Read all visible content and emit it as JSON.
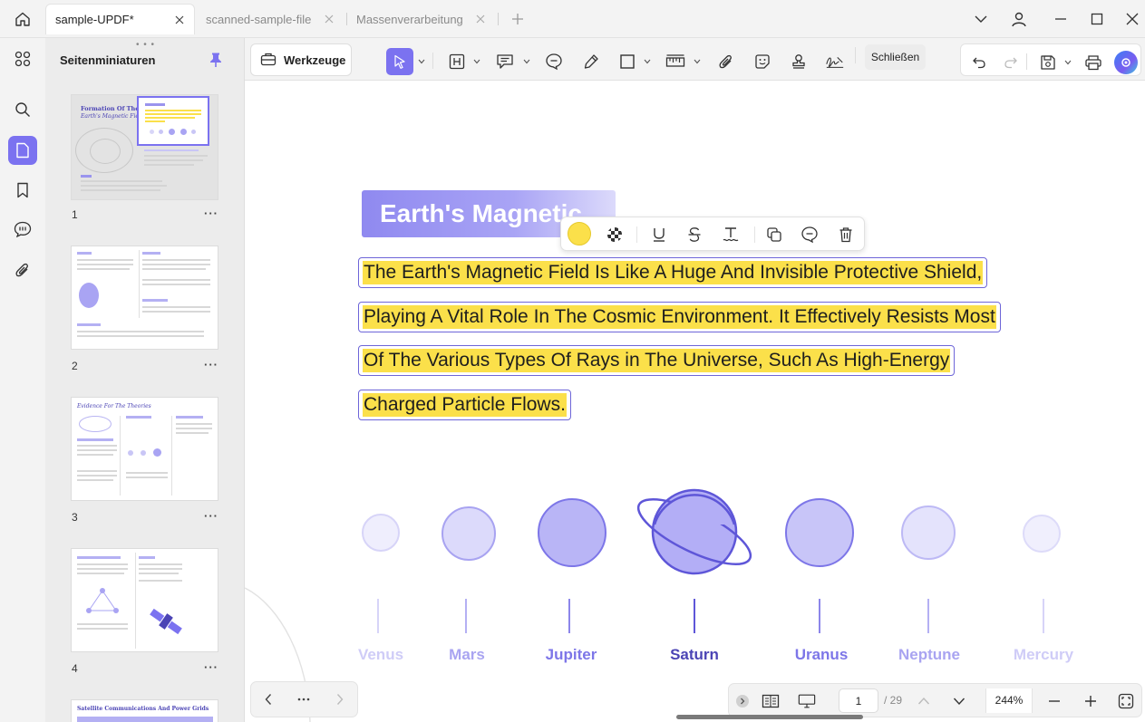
{
  "tabs": [
    {
      "label": "sample-UPDF*",
      "active": true
    },
    {
      "label": "scanned-sample-file",
      "active": false
    },
    {
      "label": "Massenverarbeitung",
      "active": false
    }
  ],
  "sidebar": {
    "title": "Seitenminiaturen",
    "pages": [
      {
        "num": "1",
        "more": "···",
        "title": "Formation Of The",
        "subtitle": "Earth's Magnetic Field"
      },
      {
        "num": "2",
        "more": "···"
      },
      {
        "num": "3",
        "more": "···",
        "title": "Evidence For The Theories"
      },
      {
        "num": "4",
        "more": "···"
      },
      {
        "title": "Satellite Communications And Power Grids"
      }
    ]
  },
  "toolbar": {
    "tools_label": "Werkzeuge",
    "close_label": "Schließen"
  },
  "document": {
    "banner": "Earth's Magnetic",
    "highlighted_lines": [
      "The Earth's Magnetic Field Is Like A Huge And Invisible Protective Shield,",
      "Playing A Vital Role In The Cosmic Environment. It Effectively Resists Most",
      "Of The Various Types Of Rays in The Universe, Such As High-Energy",
      "Charged Particle Flows."
    ],
    "highlight_color": "#fbe04a",
    "planets": [
      "Venus",
      "Mars",
      "Jupiter",
      "Saturn",
      "Uranus",
      "Neptune",
      "Mercury"
    ]
  },
  "pagination": {
    "current": "1",
    "total": "/ 29",
    "zoom": "244%"
  },
  "colors": {
    "accent": "#7b72f0",
    "highlight": "#fbe04a"
  }
}
